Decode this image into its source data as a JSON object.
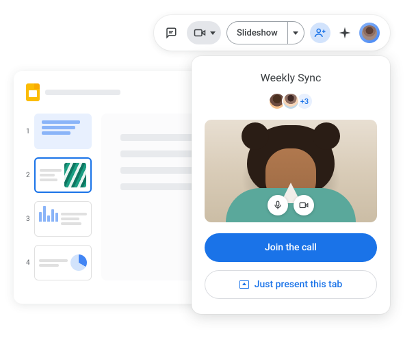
{
  "toolbar": {
    "slideshow_label": "Slideshow"
  },
  "slides": {
    "thumbs": [
      {
        "num": "1"
      },
      {
        "num": "2"
      },
      {
        "num": "3"
      },
      {
        "num": "4"
      }
    ]
  },
  "meet": {
    "title": "Weekly Sync",
    "extra_count": "+3",
    "join_label": "Join the call",
    "present_label": "Just present this tab"
  }
}
